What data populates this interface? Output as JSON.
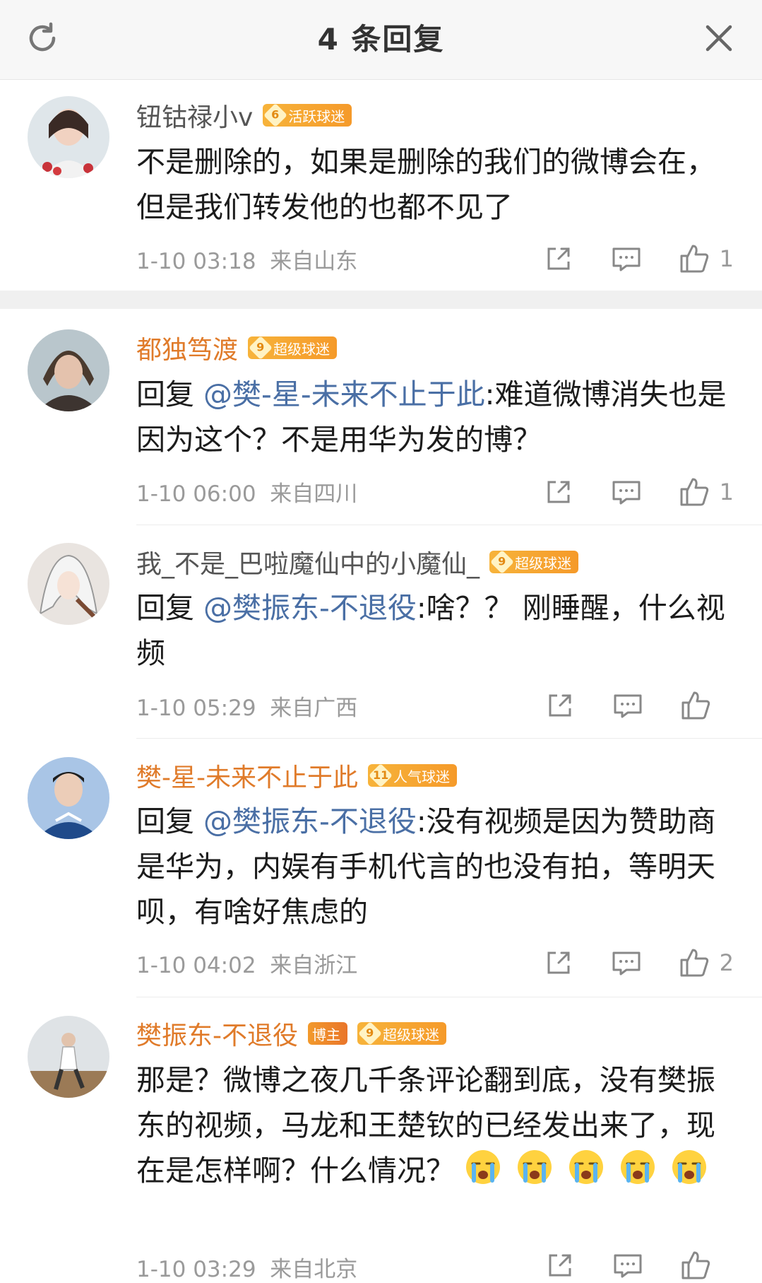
{
  "header": {
    "title": "4 条回复"
  },
  "comments": [
    {
      "username": "钮钴禄小v",
      "badges": [
        {
          "level": "6",
          "label": "活跃球迷"
        }
      ],
      "text_plain": "不是删除的，如果是删除的我们的微博会在，但是我们转发他的也都不见了",
      "reply_prefix": "",
      "mention": "",
      "text_after": "",
      "time": "1-10 03:18",
      "location": "来自山东",
      "likes": "1"
    },
    {
      "username": "都独笃渡",
      "badges": [
        {
          "level": "9",
          "label": "超级球迷"
        }
      ],
      "reply_prefix": "回复 ",
      "mention": "@樊-星-未来不止于此",
      "text_after": ":难道微博消失也是因为这个？不是用华为发的博？",
      "time": "1-10 06:00",
      "location": "来自四川",
      "likes": "1"
    },
    {
      "username": "我_不是_巴啦魔仙中的小魔仙_",
      "badges": [
        {
          "level": "9",
          "label": "超级球迷"
        }
      ],
      "reply_prefix": "回复 ",
      "mention": "@樊振东-不退役",
      "text_after": ":啥？？ 刚睡醒，什么视频",
      "time": "1-10 05:29",
      "location": "来自广西",
      "likes": ""
    },
    {
      "username": "樊-星-未来不止于此",
      "badges": [
        {
          "level": "11",
          "label": "人气球迷"
        }
      ],
      "reply_prefix": "回复 ",
      "mention": "@樊振东-不退役",
      "text_after": ":没有视频是因为赞助商是华为，内娱有手机代言的也没有拍，等明天呗，有啥好焦虑的",
      "time": "1-10 04:02",
      "location": "来自浙江",
      "likes": "2"
    },
    {
      "username": "樊振东-不退役",
      "badges": [
        {
          "level": "",
          "label": "博主"
        },
        {
          "level": "9",
          "label": "超级球迷"
        }
      ],
      "text_plain": "那是？微博之夜几千条评论翻到底，没有樊振东的视频，马龙和王楚钦的已经发出来了，现在是怎样啊？什么情况？",
      "time": "1-10 03:29",
      "location": "来自北京",
      "likes": ""
    }
  ],
  "icons": [
    "refresh-icon",
    "close-icon",
    "share-icon",
    "comment-icon",
    "like-icon",
    "crying-emoji"
  ],
  "colors": {
    "username_fan": "#e07b2a",
    "mention": "#4a6fa5",
    "meta": "#9a9a9a",
    "badge": "#f59a2a"
  }
}
